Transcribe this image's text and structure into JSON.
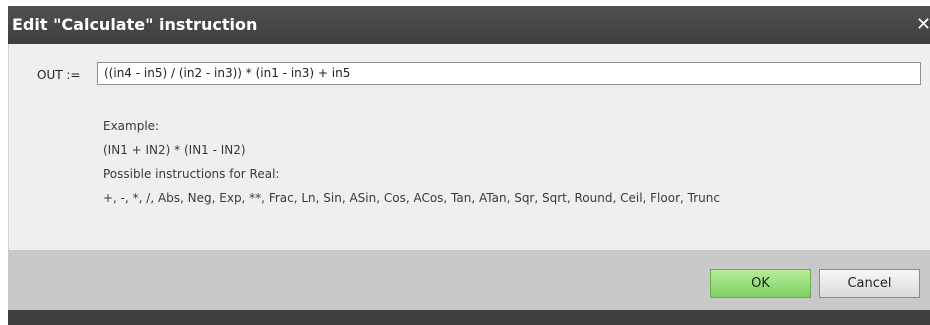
{
  "window": {
    "title": "Edit \"Calculate\" instruction",
    "close_glyph": "✕"
  },
  "formula": {
    "label": "OUT :=",
    "value": "((in4 - in5) / (in2 - in3)) * (in1 - in3) + in5"
  },
  "help": {
    "example_heading": "Example:",
    "example_formula": "(IN1 + IN2) * (IN1 - IN2)",
    "instructions_heading": "Possible instructions for Real:",
    "instructions_list": "+, -, *, /, Abs, Neg, Exp, **, Frac, Ln, Sin, ASin, Cos, ACos, Tan, ATan, Sqr, Sqrt, Round, Ceil, Floor, Trunc"
  },
  "buttons": {
    "ok": "OK",
    "cancel": "Cancel"
  },
  "colors": {
    "titlebar": "#454748",
    "content_bg": "#efefef",
    "footer_bg": "#c9c9c9",
    "ok_button": "#8fd96f"
  }
}
